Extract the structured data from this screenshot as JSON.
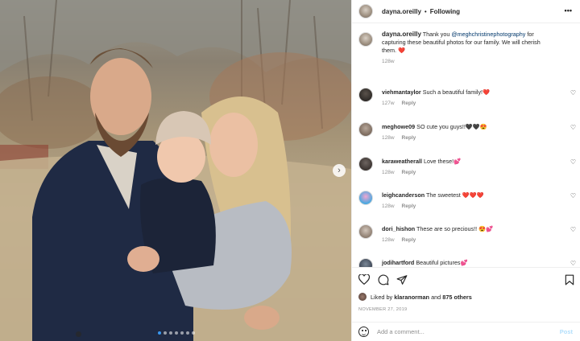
{
  "post": {
    "username": "dayna.oreilly",
    "separator": "•",
    "follow_status": "Following",
    "more_icon": "more-options-icon",
    "carousel_dots": 7,
    "carousel_active_index": 0
  },
  "caption": {
    "username": "dayna.oreilly",
    "text_before": "Thank you",
    "mention": "@meghchristinephotography",
    "text_after": "for capturing these beautiful photos for our family. We will cherish them.",
    "emoji": "❤️",
    "time": "128w"
  },
  "comments": [
    {
      "username": "viehmantaylor",
      "text": "Such a beautiful family!",
      "emoji": "❤️",
      "time": "127w",
      "reply": "Reply"
    },
    {
      "username": "meghowe09",
      "text": "SO cute you guys!!",
      "emoji": "🖤🖤😍",
      "time": "128w",
      "reply": "Reply"
    },
    {
      "username": "karaweatherall",
      "text": "Love these!",
      "emoji": "💕",
      "time": "128w",
      "reply": "Reply"
    },
    {
      "username": "leighcanderson",
      "text": "The sweetest",
      "emoji": "❤️❤️❤️",
      "time": "128w",
      "reply": "Reply"
    },
    {
      "username": "dori_hishon",
      "text": "These are so precious!!",
      "emoji": "😍💕",
      "time": "128w",
      "reply": "Reply"
    },
    {
      "username": "jodihartford",
      "text": "Beautiful pictures",
      "emoji": "💕",
      "time": "",
      "reply": ""
    }
  ],
  "likes": {
    "prefix": "Liked by",
    "user": "klaranorman",
    "and": "and",
    "count_text": "875 others"
  },
  "date": "NOVEMBER 27, 2019",
  "add_comment": {
    "placeholder": "Add a comment...",
    "post_label": "Post"
  },
  "colors": {
    "mention": "#00376b",
    "post_disabled": "#b2dffc",
    "carousel_active": "#3897f0",
    "secondary_text": "#8e8e8e"
  }
}
